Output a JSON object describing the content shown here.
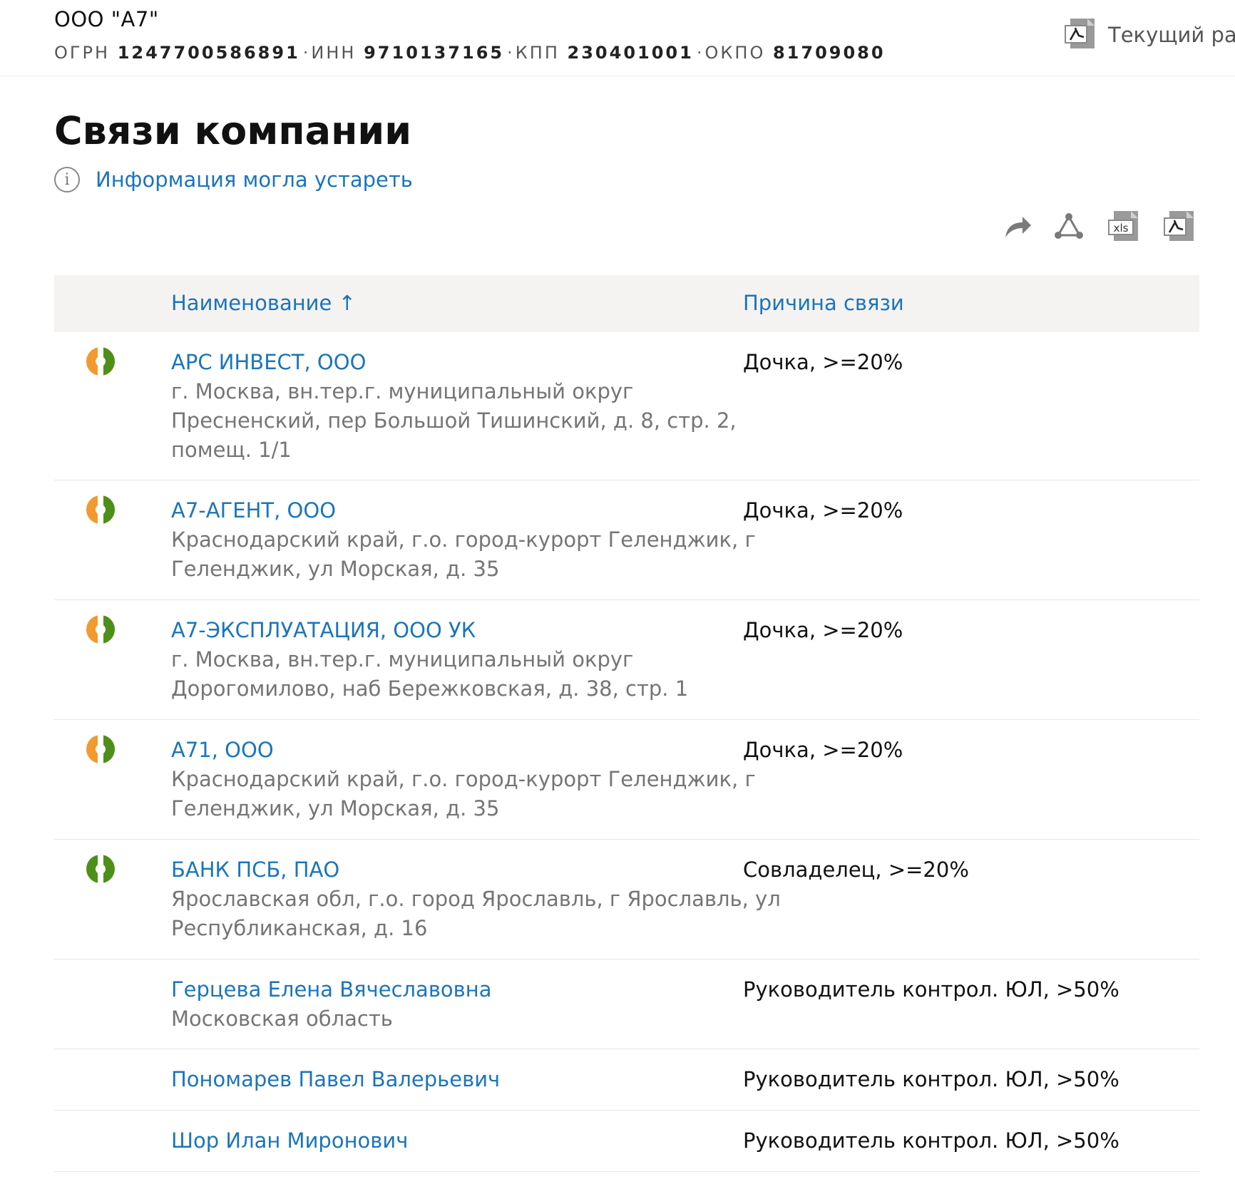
{
  "header": {
    "company_name": "ООО \"А7\"",
    "registry": [
      {
        "label": "ОГРН",
        "value": "1247700586891"
      },
      {
        "label": "ИНН",
        "value": "9710137165"
      },
      {
        "label": "КПП",
        "value": "230401001"
      },
      {
        "label": "ОКПО",
        "value": "81709080"
      }
    ],
    "separator": "·",
    "current_section_label": "Текущий раз",
    "current_section_icon": "pdf-icon"
  },
  "page": {
    "title": "Связи компании",
    "info_icon": "info-icon",
    "info_link": "Информация могла устареть"
  },
  "toolbar": {
    "icons": [
      "share-icon",
      "graph-icon",
      "xls-export-icon",
      "pdf-export-icon"
    ],
    "xls_text": "xls"
  },
  "table": {
    "columns": {
      "name": "Наименование ↑",
      "reason": "Причина связи"
    },
    "rows": [
      {
        "name": "АРС ИНВЕСТ, ООО",
        "address": "г. Москва, вн.тер.г. муниципальный округ Пресненский, пер Большой Тишинский, д. 8, стр. 2, помещ. 1/1",
        "reason": "Дочка, >=20%",
        "icon": "subsidiary-status-icon"
      },
      {
        "name": "А7-АГЕНТ, ООО",
        "address": "Краснодарский край, г.о. город-курорт Геленджик, г Геленджик, ул Морская, д. 35",
        "reason": "Дочка, >=20%",
        "icon": "subsidiary-status-icon"
      },
      {
        "name": "А7-ЭКСПЛУАТАЦИЯ, ООО УК",
        "address": "г. Москва, вн.тер.г. муниципальный округ Дорогомилово, наб Бережковская, д. 38, стр. 1",
        "reason": "Дочка, >=20%",
        "icon": "subsidiary-status-icon"
      },
      {
        "name": "А71, ООО",
        "address": "Краснодарский край, г.о. город-курорт Геленджик, г Геленджик, ул Морская, д. 35",
        "reason": "Дочка, >=20%",
        "icon": "subsidiary-status-icon"
      },
      {
        "name": "БАНК ПСБ, ПАО",
        "address": "Ярославская обл, г.о. город Ярославль, г Ярославль, ул Республиканская, д. 16",
        "reason": "Совладелец, >=20%",
        "icon": "coowner-status-icon"
      },
      {
        "name": "Герцева Елена Вячеславовна",
        "address": "Московская область",
        "reason": "Руководитель контрол. ЮЛ, >50%",
        "icon": ""
      },
      {
        "name": "Пономарев Павел Валерьевич",
        "address": "",
        "reason": "Руководитель контрол. ЮЛ, >50%",
        "icon": ""
      },
      {
        "name": "Шор Илан Миронович",
        "address": "",
        "reason": "Руководитель контрол. ЮЛ, >50%",
        "icon": ""
      }
    ]
  },
  "colors": {
    "link": "#1b75bb",
    "status_orange": "#f29a2e",
    "status_green": "#4e8f1a",
    "header_bg": "#f5f3f1",
    "muted_text": "#757575",
    "divider": "#e6e6e6"
  }
}
